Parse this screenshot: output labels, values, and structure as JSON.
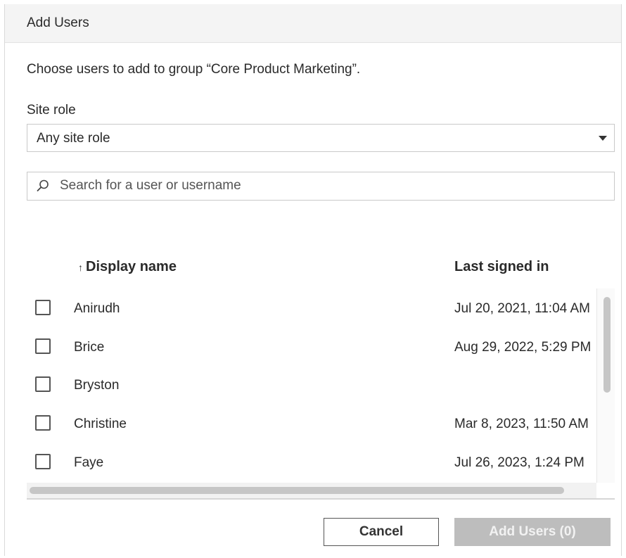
{
  "dialog": {
    "title": "Add Users",
    "instruction": "Choose users to add to group “Core Product Marketing”.",
    "site_role": {
      "label": "Site role",
      "selected": "Any site role"
    },
    "search": {
      "placeholder": "Search for a user or username",
      "value": ""
    },
    "table": {
      "columns": {
        "display_name": "Display name",
        "sort_indicator": "↑",
        "last_signed_in": "Last signed in"
      },
      "rows": [
        {
          "name": "Anirudh",
          "last_signed_in": "Jul 20, 2021, 11:04 AM",
          "checked": false
        },
        {
          "name": "Brice",
          "last_signed_in": "Aug 29, 2022, 5:29 PM",
          "checked": false
        },
        {
          "name": "Bryston",
          "last_signed_in": "",
          "checked": false
        },
        {
          "name": "Christine",
          "last_signed_in": "Mar 8, 2023, 11:50 AM",
          "checked": false
        },
        {
          "name": "Faye",
          "last_signed_in": "Jul 26, 2023, 1:24 PM",
          "checked": false
        }
      ]
    },
    "buttons": {
      "cancel": "Cancel",
      "add_users": "Add Users (0)"
    },
    "colors": {
      "title_bar": "#f4f4f4",
      "disabled_button": "#bdbdbd",
      "border": "#c9c9c9"
    }
  }
}
